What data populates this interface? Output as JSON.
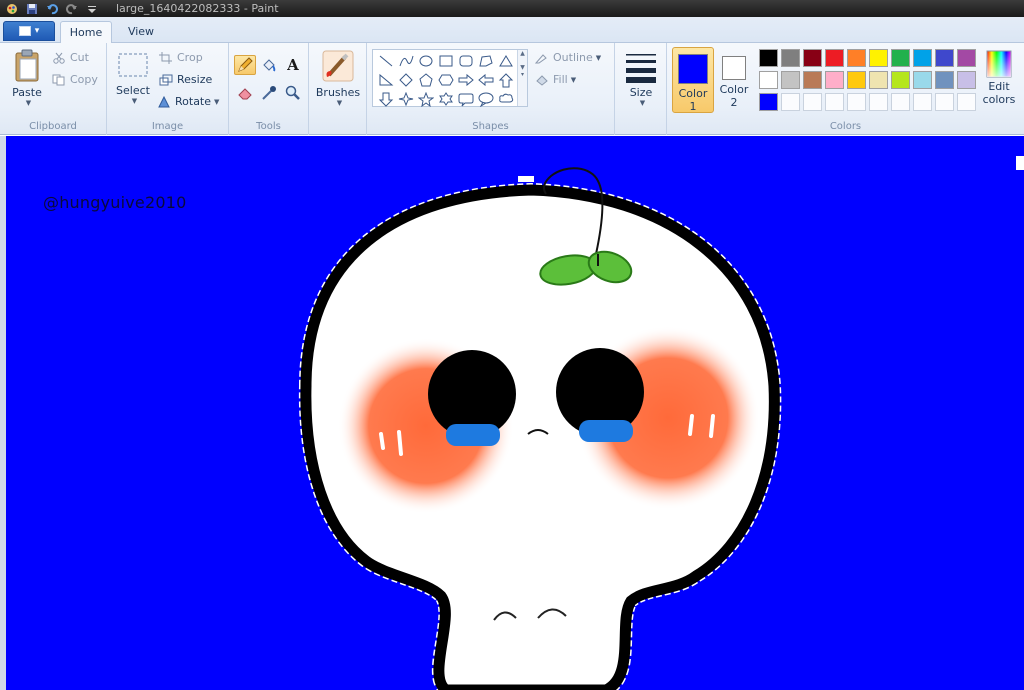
{
  "window": {
    "title": "large_1640422082333 - Paint"
  },
  "tabs": [
    {
      "label": "Home",
      "active": true
    },
    {
      "label": "View",
      "active": false
    }
  ],
  "ribbon": {
    "clipboard": {
      "label": "Clipboard",
      "paste": "Paste",
      "cut": "Cut",
      "copy": "Copy"
    },
    "image": {
      "label": "Image",
      "select": "Select",
      "crop": "Crop",
      "resize": "Resize",
      "rotate": "Rotate"
    },
    "tools": {
      "label": "Tools",
      "active_tool": "pencil",
      "text_tool_glyph": "A"
    },
    "brushes": {
      "label": "Brushes"
    },
    "shapes": {
      "label": "Shapes",
      "outline": "Outline",
      "fill": "Fill"
    },
    "size": {
      "label": "Size"
    },
    "colors": {
      "label": "Colors",
      "color1_label": "Color",
      "color1_num": "1",
      "color1_value": "#0000ff",
      "color2_label": "Color",
      "color2_num": "2",
      "color2_value": "#ffffff",
      "edit_label_1": "Edit",
      "edit_label_2": "colors",
      "palette_row1": [
        "#000000",
        "#7f7f7f",
        "#880015",
        "#ed1c24",
        "#ff7f27",
        "#fff200",
        "#22b14c",
        "#00a2e8",
        "#3f48cc",
        "#a349a4"
      ],
      "palette_row2": [
        "#ffffff",
        "#c3c3c3",
        "#b97a57",
        "#ffaec9",
        "#ffc90e",
        "#efe4b0",
        "#b5e61d",
        "#99d9ea",
        "#7092be",
        "#c8bfe7"
      ],
      "palette_row3": [
        "#0000ff",
        "",
        "",
        "",
        "",
        "",
        "",
        "",
        "",
        ""
      ]
    }
  },
  "canvas": {
    "background": "#0000ff",
    "watermark": "@hungyuive2010"
  }
}
